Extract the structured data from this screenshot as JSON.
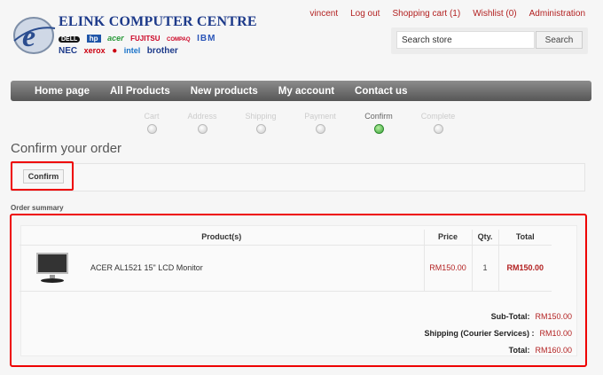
{
  "brand": {
    "title": "ELINK COMPUTER CENTRE",
    "logos_row1": [
      "DELL",
      "hp",
      "acer",
      "FUJITSU",
      "COMPAQ",
      "IBM"
    ],
    "logos_row2": [
      "NEC",
      "xerox",
      "TOSHIBA",
      "intel",
      "brother"
    ]
  },
  "header_links": [
    "vincent",
    "Log out",
    "Shopping cart (1)",
    "Wishlist (0)",
    "Administration"
  ],
  "search": {
    "placeholder": "Search store",
    "button": "Search"
  },
  "nav": [
    "Home page",
    "All Products",
    "New products",
    "My account",
    "Contact us"
  ],
  "steps": [
    {
      "label": "Cart",
      "active": false
    },
    {
      "label": "Address",
      "active": false
    },
    {
      "label": "Shipping",
      "active": false
    },
    {
      "label": "Payment",
      "active": false
    },
    {
      "label": "Confirm",
      "active": true
    },
    {
      "label": "Complete",
      "active": false
    }
  ],
  "page_title": "Confirm your order",
  "confirm_button": "Confirm",
  "summary_label": "Order summary",
  "table": {
    "headers": {
      "product": "Product(s)",
      "price": "Price",
      "qty": "Qty.",
      "total": "Total"
    },
    "rows": [
      {
        "name": "ACER AL1521 15\" LCD Monitor",
        "price": "RM150.00",
        "qty": "1",
        "total": "RM150.00",
        "image": "lcd-monitor-icon"
      }
    ]
  },
  "totals": {
    "subtotal_label": "Sub-Total:",
    "subtotal_value": "RM150.00",
    "shipping_label": "Shipping (Courier Services) :",
    "shipping_value": "RM10.00",
    "total_label": "Total:",
    "total_value": "RM160.00"
  },
  "colors": {
    "accent_red": "#b32222",
    "nav_bar": "#6e6e6e",
    "active_step": "#3aa23a",
    "highlight": "#ee0000"
  }
}
